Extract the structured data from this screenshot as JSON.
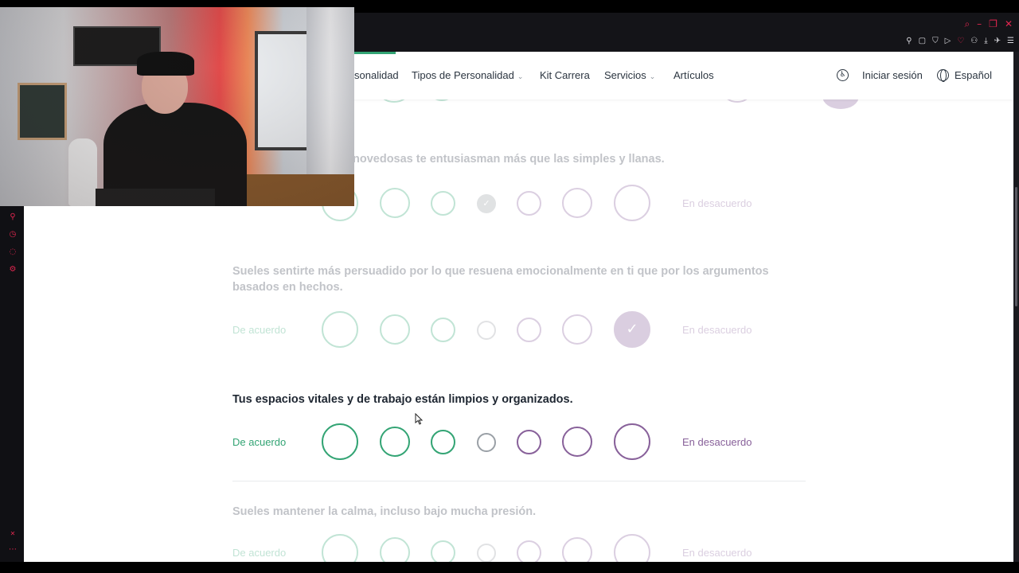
{
  "nav": {
    "items": [
      "sonalidad",
      "Tipos de Personalidad",
      "Kit Carrera",
      "Servicios",
      "Artículos"
    ],
    "login": "Iniciar sesión",
    "language": "Español"
  },
  "questions": [
    {
      "text": "novedosas te entusiasman más que las simples y llanas.",
      "agree": "",
      "disagree": "En desacuerdo",
      "selected": 4,
      "state": "faded"
    },
    {
      "text": "Sueles sentirte más persuadido por lo que resuena emocionalmente en ti que por los argumentos basados en hechos.",
      "agree": "De acuerdo",
      "disagree": "En desacuerdo",
      "selected": 7,
      "state": "faded"
    },
    {
      "text": "Tus espacios vitales y de trabajo están limpios y organizados.",
      "agree": "De acuerdo",
      "disagree": "En desacuerdo",
      "selected": 0,
      "state": "active"
    },
    {
      "text": "Sueles mantener la calma, incluso bajo mucha presión.",
      "agree": "De acuerdo",
      "disagree": "En desacuerdo",
      "selected": 0,
      "state": "faded"
    }
  ],
  "colors": {
    "agree": "#33a474",
    "neutral": "#9aa0a6",
    "disagree": "#88619a",
    "browser_accent": "#e0264f"
  },
  "icons": {
    "window": [
      "search-icon",
      "minimize-icon",
      "restore-icon",
      "close-icon"
    ],
    "toolbar": [
      "pin-icon",
      "snapshot-icon",
      "shield-icon",
      "play-icon",
      "heart-icon",
      "profile-icon",
      "download-icon",
      "ai-icon",
      "menu-icon"
    ],
    "sidebar": [
      "pin-icon",
      "history-icon",
      "chat-icon",
      "settings-icon",
      "gx-icon",
      "more-icon"
    ]
  }
}
